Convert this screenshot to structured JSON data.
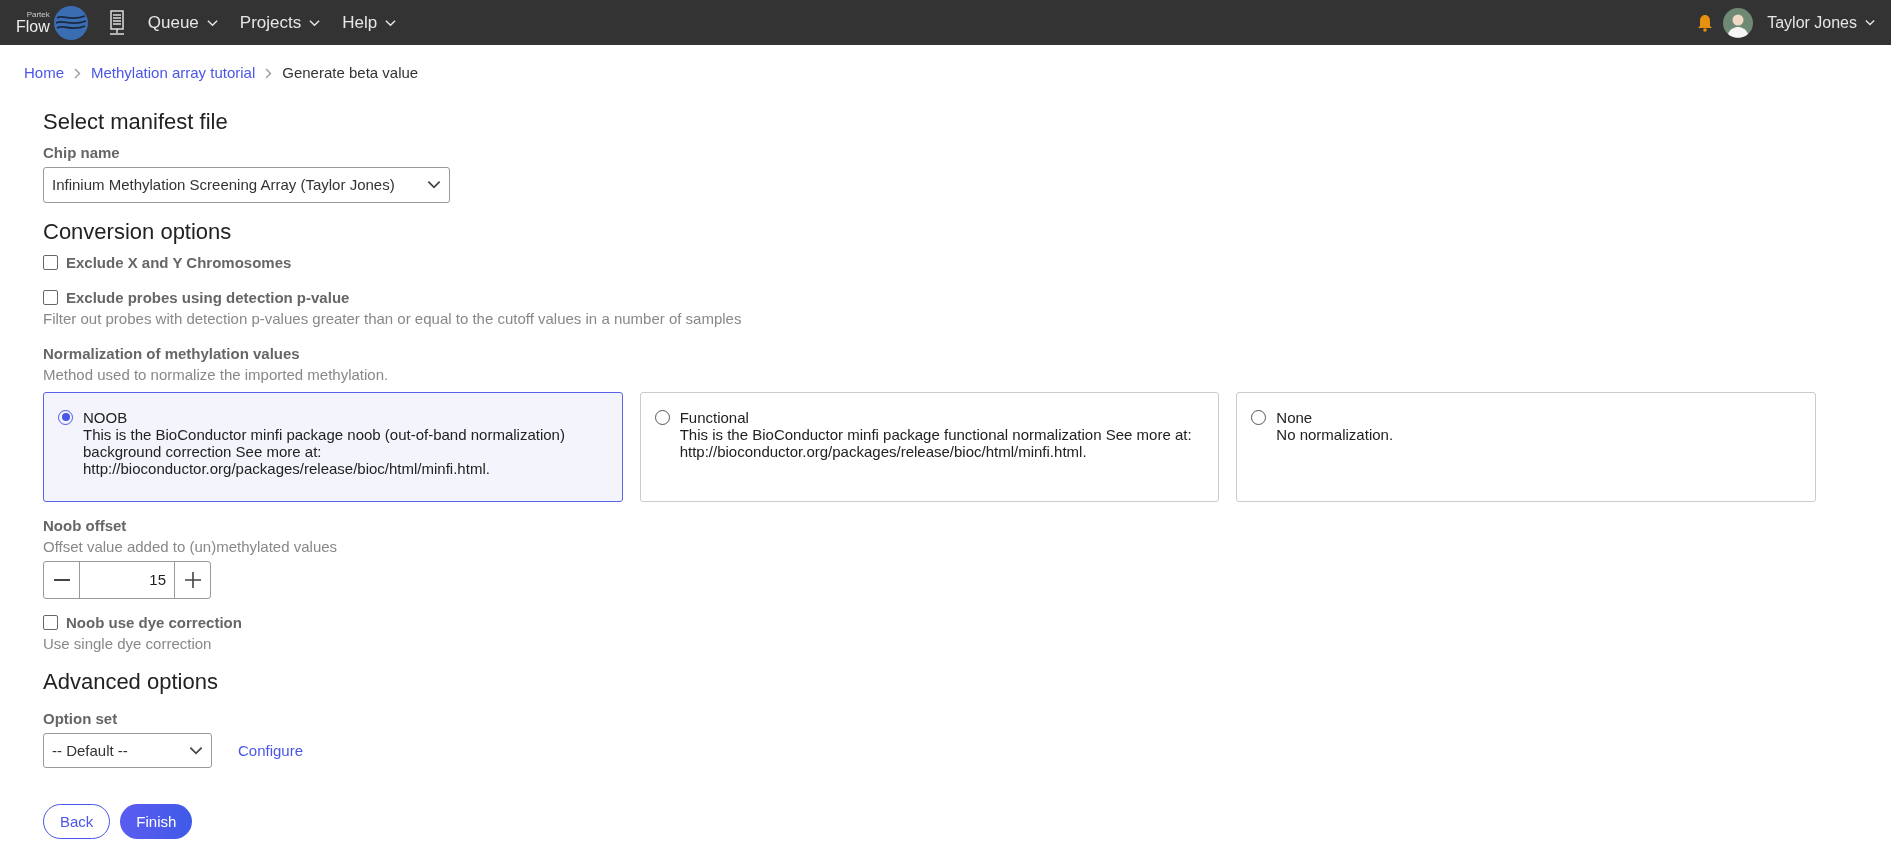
{
  "topbar": {
    "logo": {
      "small": "Partek",
      "name": "Flow"
    },
    "menus": [
      {
        "label": "Queue"
      },
      {
        "label": "Projects"
      },
      {
        "label": "Help"
      }
    ],
    "user": "Taylor Jones"
  },
  "breadcrumb": [
    {
      "label": "Home",
      "link": true
    },
    {
      "label": "Methylation array tutorial",
      "link": true
    },
    {
      "label": "Generate beta value",
      "link": false
    }
  ],
  "manifest": {
    "heading": "Select manifest file",
    "label": "Chip name",
    "value": "Infinium Methylation Screening Array (Taylor Jones)"
  },
  "conversion": {
    "heading": "Conversion options",
    "exclude_xy": {
      "label": "Exclude X and Y Chromosomes",
      "checked": false
    },
    "exclude_probes": {
      "label": "Exclude probes using detection p-value",
      "checked": false,
      "hint": "Filter out probes with detection p-values greater than or equal to the cutoff values in a number of samples"
    },
    "normalization": {
      "label": "Normalization of methylation values",
      "hint": "Method used to normalize the imported methylation.",
      "options": [
        {
          "title": "NOOB",
          "description": "This is the BioConductor minfi package noob (out-of-band normalization) background correction See more at: http://bioconductor.org/packages/release/bioc/html/minfi.html.",
          "selected": true
        },
        {
          "title": "Functional",
          "description": "This is the BioConductor minfi package functional normalization See more at: http://bioconductor.org/packages/release/bioc/html/minfi.html.",
          "selected": false
        },
        {
          "title": "None",
          "description": "No normalization.",
          "selected": false
        }
      ]
    },
    "noob_offset": {
      "label": "Noob offset",
      "hint": "Offset value added to (un)methylated values",
      "value": "15"
    },
    "dye": {
      "label": "Noob use dye correction",
      "checked": false,
      "hint": "Use single dye correction"
    }
  },
  "advanced": {
    "heading": "Advanced options",
    "label": "Option set",
    "value": "-- Default --",
    "link": "Configure"
  },
  "buttons": [
    {
      "label": "Back",
      "kind": "outline"
    },
    {
      "label": "Finish",
      "kind": "primary"
    }
  ]
}
